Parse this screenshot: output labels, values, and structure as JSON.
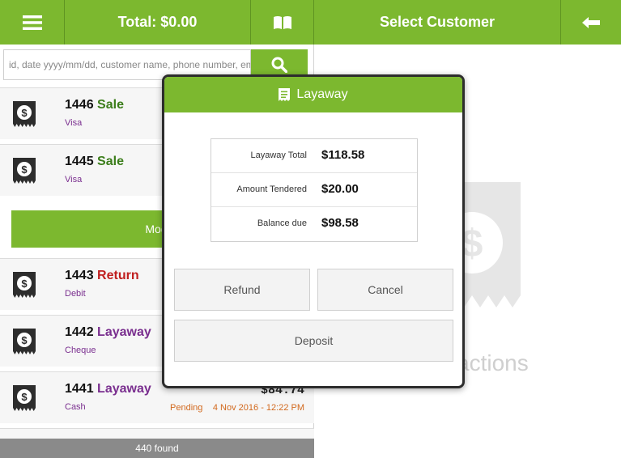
{
  "header": {
    "total_label": "Total: $0.00",
    "select_customer_label": "Select Customer"
  },
  "search": {
    "placeholder": "id, date yyyy/mm/dd, customer name, phone number, email"
  },
  "transactions": [
    {
      "id": "1446",
      "type": "Sale",
      "type_color": "#3b7d1a",
      "method": "Visa"
    },
    {
      "id": "1445",
      "type": "Sale",
      "type_color": "#3b7d1a",
      "method": "Visa"
    },
    {
      "id": "1443",
      "type": "Return",
      "type_color": "#c02020",
      "method": "Debit"
    },
    {
      "id": "1442",
      "type": "Layaway",
      "type_color": "#7a2f8f",
      "method": "Cheque"
    },
    {
      "id": "1441",
      "type": "Layaway",
      "type_color": "#7a2f8f",
      "method": "Cash",
      "amount": "$84.74",
      "status": "Pending",
      "date": "4 Nov 2016 - 12:22 PM"
    }
  ],
  "modify_label": "Modify",
  "footer": {
    "count_label": "440 found"
  },
  "background": {
    "partial_label": "actions"
  },
  "modal": {
    "title": "Layaway",
    "rows": [
      {
        "label": "Layaway Total",
        "value": "$118.58"
      },
      {
        "label": "Amount Tendered",
        "value": "$20.00"
      },
      {
        "label": "Balance due",
        "value": "$98.58"
      }
    ],
    "refund_label": "Refund",
    "cancel_label": "Cancel",
    "deposit_label": "Deposit"
  },
  "colors": {
    "accent": "#7cb82f",
    "sale": "#3b7d1a",
    "return": "#c02020",
    "layaway": "#7a2f8f",
    "pending": "#d2691e"
  },
  "icons": [
    "menu-icon",
    "book-icon",
    "back-arrow-icon",
    "search-icon",
    "receipt-dollar-icon",
    "receipt-icon"
  ]
}
